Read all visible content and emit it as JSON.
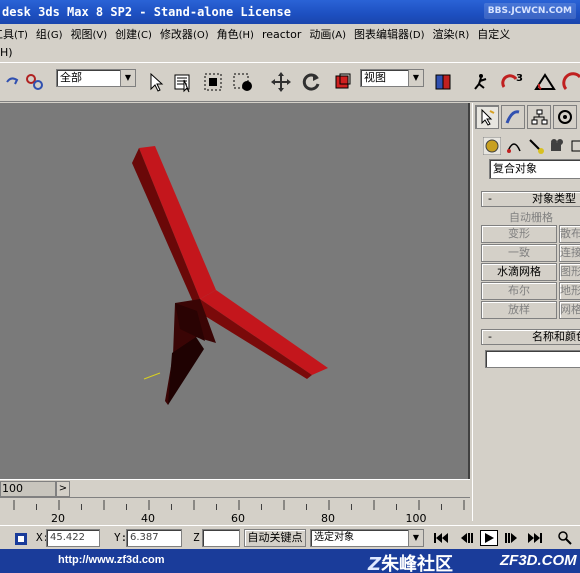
{
  "window": {
    "title": "desk 3ds Max 8 SP2  - Stand-alone License",
    "watermark": "BBS.JCWCN.COM"
  },
  "menubar": {
    "items": [
      {
        "label": "工具",
        "key": "(T)"
      },
      {
        "label": "组",
        "key": "(G)"
      },
      {
        "label": "视图",
        "key": "(V)"
      },
      {
        "label": "创建",
        "key": "(C)"
      },
      {
        "label": "修改器",
        "key": "(O)"
      },
      {
        "label": "角色",
        "key": "(H)"
      },
      {
        "label": "reactor",
        "key": ""
      },
      {
        "label": "动画",
        "key": "(A)"
      },
      {
        "label": "图表编辑器",
        "key": "(D)"
      },
      {
        "label": "渲染",
        "key": "(R)"
      },
      {
        "label": "自定义",
        "key": ""
      }
    ],
    "overflow": "H)"
  },
  "toolbar": {
    "selection_filter": "全部",
    "reference_coord": "视图",
    "icons": [
      "undo-icon",
      "link-icon",
      "select-icon",
      "select-by-name-icon",
      "rect-region-icon",
      "window-crossing-icon",
      "move-icon",
      "rotate-icon",
      "scale-icon",
      "pivot-icon",
      "mirror-icon",
      "snap-icon",
      "angle-snap-icon",
      "percent-snap-icon"
    ],
    "snap_label": "3"
  },
  "command_panel": {
    "tabs": [
      "create-tab",
      "modify-tab",
      "hierarchy-tab",
      "motion-tab"
    ],
    "category_dropdown": "复合对象",
    "object_type": {
      "title": "对象类型",
      "autogrid": "自动栅格",
      "buttons": [
        {
          "label": "变形",
          "enabled": false
        },
        {
          "label": "散布",
          "enabled": false
        },
        {
          "label": "一致",
          "enabled": false
        },
        {
          "label": "连接",
          "enabled": false
        },
        {
          "label": "水滴网格",
          "enabled": true
        },
        {
          "label": "图形合并",
          "enabled": false
        },
        {
          "label": "布尔",
          "enabled": false
        },
        {
          "label": "地形",
          "enabled": false
        },
        {
          "label": "放样",
          "enabled": false
        },
        {
          "label": "网格化",
          "enabled": false
        }
      ]
    },
    "name_color": {
      "title": "名称和颜色"
    }
  },
  "timeline": {
    "frame_display": "100",
    "ruler_labels": [
      "20",
      "40",
      "60",
      "80",
      "100"
    ]
  },
  "statusbar": {
    "x_label": "X:",
    "x_value": "45.422",
    "y_label": "Y:",
    "y_value": "6.387",
    "z_label": "Z",
    "autokey_label": "自动关键点",
    "selection_mode": "选定对象"
  },
  "banner": {
    "url": "http://www.zf3d.com",
    "logo_text": "朱峰社区",
    "brand": "ZF3D.COM"
  },
  "colors": {
    "titlebar": "#1d4fc0",
    "viewport_bg": "#7a7a7a",
    "object_red": "#c4161c",
    "object_dark": "#3a0505",
    "banner_bg": "#1a3c9a"
  }
}
